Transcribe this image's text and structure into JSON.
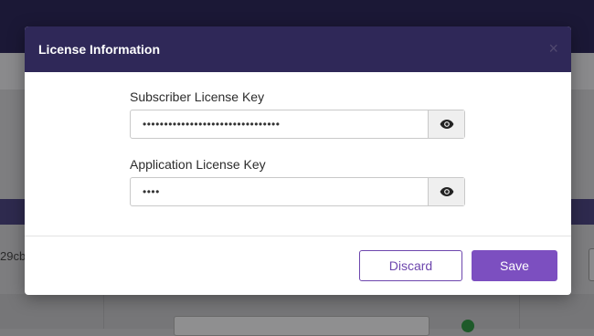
{
  "background": {
    "partial_text": "29cb"
  },
  "modal": {
    "title": "License Information",
    "close_glyph": "×",
    "fields": [
      {
        "label": "Subscriber License Key",
        "masked_value": "••••••••••••••••••••••••••••••••",
        "toggle_icon": "eye-icon"
      },
      {
        "label": "Application License Key",
        "masked_value": "••••",
        "toggle_icon": "eye-icon"
      }
    ],
    "discard_label": "Discard",
    "save_label": "Save"
  },
  "colors": {
    "header_bg": "#2f2858",
    "accent": "#7c4fc0",
    "discard_border": "#6d46ad"
  }
}
